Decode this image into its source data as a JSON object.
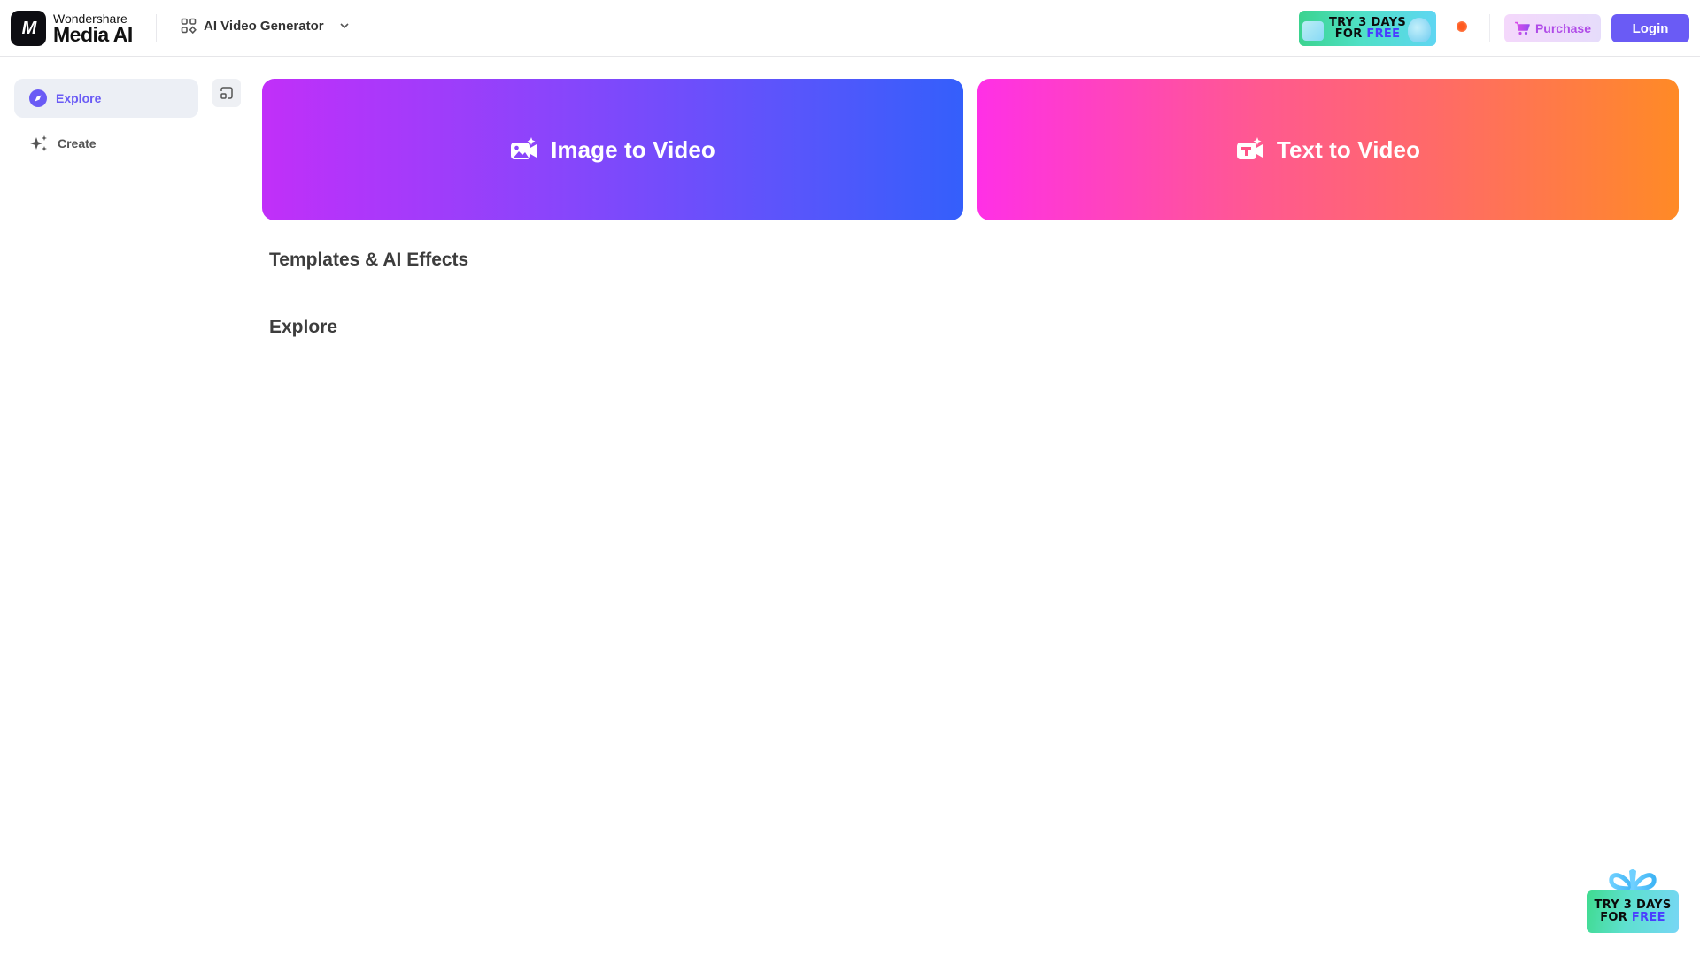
{
  "header": {
    "logo_top": "Wondershare",
    "logo_bottom": "Media AI",
    "logo_mark": "M",
    "product_switcher": "AI Video Generator",
    "promo_line1": "TRY 3 DAYS",
    "promo_line2_prefix": "FOR ",
    "promo_line2_highlight": "FREE",
    "purchase_label": "Purchase",
    "login_label": "Login"
  },
  "sidebar": {
    "items": [
      {
        "label": "Explore",
        "icon": "compass-icon",
        "active": true
      },
      {
        "label": "Create",
        "icon": "sparkle-icon",
        "active": false
      }
    ]
  },
  "main": {
    "cards": [
      {
        "label": "Image to Video",
        "icon": "image-video-icon"
      },
      {
        "label": "Text to Video",
        "icon": "text-video-icon"
      }
    ],
    "sections": [
      {
        "title": "Templates & AI Effects"
      },
      {
        "title": "Explore"
      }
    ]
  },
  "floating_promo": {
    "line1": "TRY 3 DAYS",
    "line2_prefix": "FOR ",
    "line2_highlight": "FREE"
  },
  "colors": {
    "accent": "#6a5bf5",
    "purchase_text": "#b04ae8",
    "status_dot": "#ff5a1f"
  }
}
